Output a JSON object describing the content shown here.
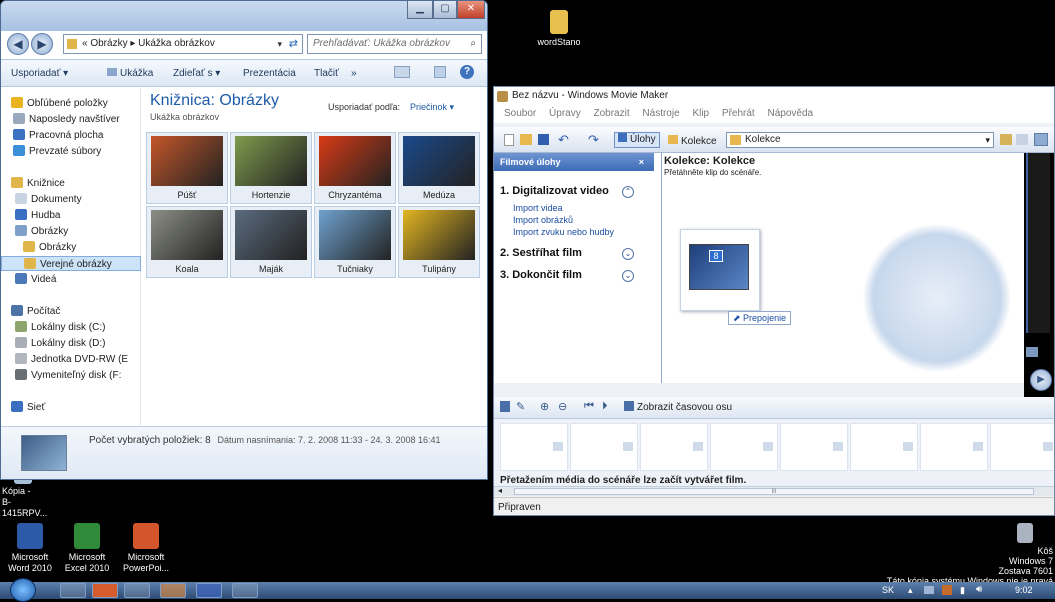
{
  "desktop": {
    "icons": [
      {
        "label": "wordStano"
      },
      {
        "label": "Kópia -\nB-1415RPV..."
      },
      {
        "label": "Microsoft\nWord 2010"
      },
      {
        "label": "Microsoft\nExcel 2010"
      },
      {
        "label": "Microsoft\nPowerPoi..."
      },
      {
        "label": "Kôš"
      }
    ],
    "watermark": [
      "Windows 7",
      "Zostava 7601",
      "Táto kópia systému Windows nie je pravá"
    ]
  },
  "explorer": {
    "address": {
      "back": "◀",
      "forward": "▶",
      "crumbs": "« Obrázky ▸ Ukážka obrázkov",
      "search_placeholder": "Prehľadávať: Ukážka obrázkov"
    },
    "toolbar": [
      "Usporiadať ▾",
      "Ukážka",
      "Zdieľať s ▾",
      "Prezentácia",
      "Tlačiť",
      "»"
    ],
    "nav": [
      {
        "label": "Obľúbené položky",
        "color": "#e8b521"
      },
      {
        "label": "Naposledy navštíver",
        "color": "#9aa9bd"
      },
      {
        "label": "Pracovná plocha",
        "color": "#3b71c1"
      },
      {
        "label": "Prevzaté súbory",
        "color": "#3b8fd8"
      },
      {
        "label": "Knižnice",
        "color": "#e0b64a"
      },
      {
        "label": "Dokumenty",
        "color": "#c9d4e3"
      },
      {
        "label": "Hudba",
        "color": "#3a6fc4"
      },
      {
        "label": "Obrázky",
        "color": "#7fa0c9"
      },
      {
        "label": "Obrázky",
        "color": "#e0b64a"
      },
      {
        "label": "Verejné obrázky",
        "color": "#e0b64a"
      },
      {
        "label": "Videá",
        "color": "#4a78b9"
      },
      {
        "label": "Počítač",
        "color": "#4c74a8"
      },
      {
        "label": "Lokálny disk (C:)",
        "color": "#8ba56d"
      },
      {
        "label": "Lokálny disk (D:)",
        "color": "#a9afb6"
      },
      {
        "label": "Jednotka DVD-RW (E",
        "color": "#b0b6be"
      },
      {
        "label": "Vymeniteľný disk (F:",
        "color": "#6a6f76"
      },
      {
        "label": "Sieť",
        "color": "#3a6ec0"
      }
    ],
    "library_title": "Knižnica: Obrázky",
    "library_sub": "Ukážka obrázkov",
    "arrange_label": "Usporiadať podľa:",
    "arrange_value": "Priečinok ▾",
    "thumbs": [
      {
        "label": "Púšť",
        "color": "#c4572a"
      },
      {
        "label": "Hortenzie",
        "color": "#7f9c4d"
      },
      {
        "label": "Chryzantéma",
        "color": "#d83b16"
      },
      {
        "label": "Medúza",
        "color": "#1b4a8c"
      },
      {
        "label": "Koala",
        "color": "#8c8f86"
      },
      {
        "label": "Maják",
        "color": "#5a6b7e"
      },
      {
        "label": "Tučniaky",
        "color": "#6fa2cf"
      },
      {
        "label": "Tulipány",
        "color": "#e2b521"
      }
    ],
    "status": "Počet vybratých položiek: 8",
    "status_date": "Dátum nasnímania: 7. 2. 2008 11:33 - 24. 3. 2008 16:41"
  },
  "wmm": {
    "title": "Bez názvu - Windows Movie Maker",
    "menu": [
      "Soubor",
      "Úpravy",
      "Zobrazit",
      "Nástroje",
      "Klip",
      "Přehrát",
      "Nápověda"
    ],
    "tool_ulohy": "Úlohy",
    "tool_kolekce": "Kolekce",
    "tool_dropdown": "Kolekce",
    "tasks_header": "Filmové úlohy",
    "tasks_close": "×",
    "task1": "1. Digitalizovat video",
    "task1_links": [
      "Import videa",
      "Import obrázků",
      "Import zvuku nebo hudby"
    ],
    "task2": "2. Sestříhat film",
    "task3": "3. Dokončit film",
    "coll_title": "Kolekce: Kolekce",
    "coll_sub": "Přetáhněte klip do scénáře.",
    "clip_badge": "8",
    "clip_label": "Prepojenie",
    "timeline_label": "Zobrazit časovou osu",
    "story_hint": "Přetažením média do scénáře lze začít vytvářet film.",
    "scroll_mid": "III",
    "status": "Připraven"
  },
  "taskbar": {
    "lang": "SK",
    "time": "9:02"
  }
}
